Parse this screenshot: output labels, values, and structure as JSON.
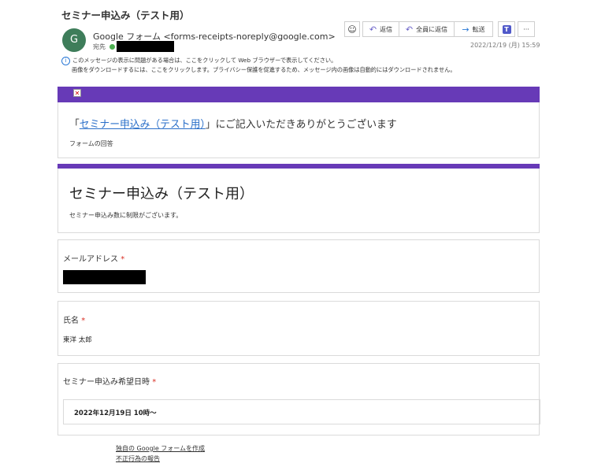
{
  "email": {
    "subject": "セミナー申込み（テスト用）",
    "avatar_letter": "G",
    "sender": "Google フォーム <forms-receipts-noreply@google.com>",
    "to_label": "宛先",
    "date": "2022/12/19 (月) 15:59",
    "info_line1": "このメッセージの表示に問題がある場合は、ここをクリックして Web ブラウザーで表示してください。",
    "info_line2": "画像をダウンロードするには、ここをクリックします。プライバシー保護を促進するため、メッセージ内の画像は自動的にはダウンロードされません。"
  },
  "toolbar": {
    "reply": "返信",
    "reply_all": "全員に返信",
    "forward": "転送",
    "more": "···"
  },
  "header_card": {
    "thanks_prefix": "「",
    "thanks_link": "セミナー申込み（テスト用）",
    "thanks_suffix": "」にご記入いただきありがとうございます",
    "response_label": "フォームの回答"
  },
  "form": {
    "title": "セミナー申込み（テスト用）",
    "description": "セミナー申込み数に制限がございます。",
    "required_mark": "*",
    "questions": [
      {
        "label": "メールアドレス",
        "answer": ""
      },
      {
        "label": "氏名",
        "answer": "東洋 太郎"
      },
      {
        "label": "セミナー申込み希望日時",
        "answer": "2022年12月19日 10時〜"
      }
    ]
  },
  "footer": {
    "create_link": "独自の Google フォームを作成",
    "abuse_link": "不正行為の報告"
  },
  "colors": {
    "accent": "#673ab7",
    "required": "#d93025",
    "link": "#2a6fc9"
  }
}
